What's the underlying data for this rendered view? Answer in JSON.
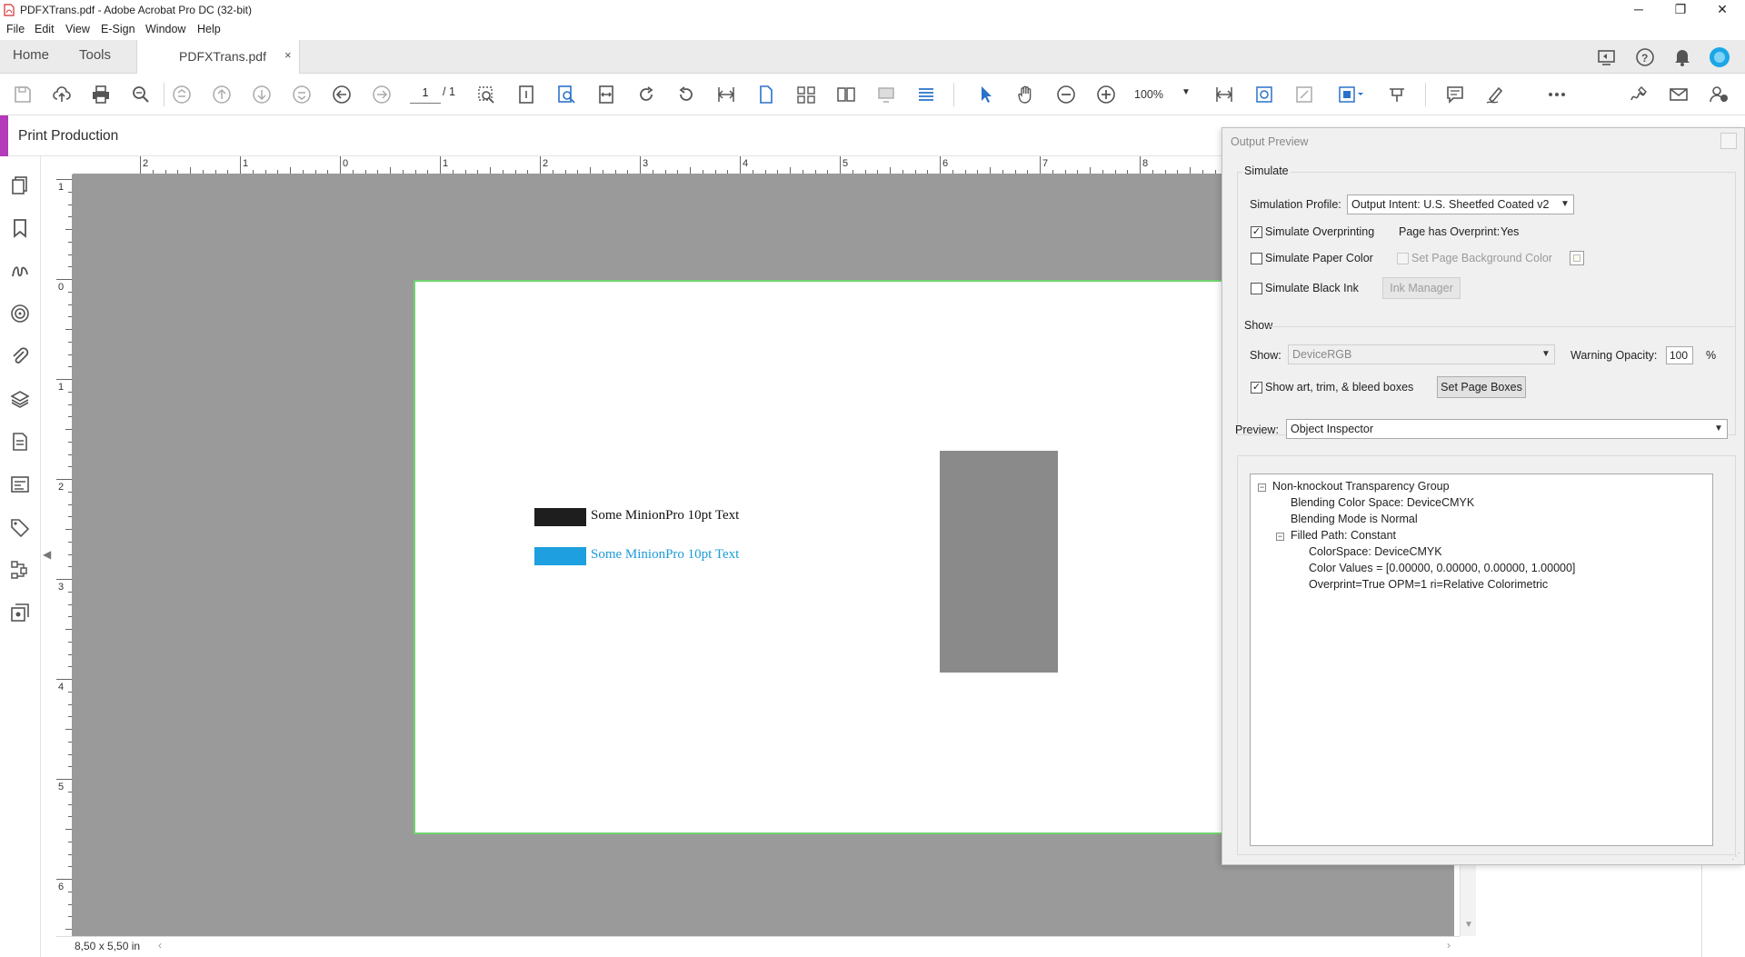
{
  "window": {
    "title": "PDFXTrans.pdf - Adobe Acrobat Pro DC (32-bit)"
  },
  "menu": [
    "File",
    "Edit",
    "View",
    "E-Sign",
    "Window",
    "Help"
  ],
  "tabs": {
    "home": "Home",
    "tools": "Tools",
    "document": "PDFXTrans.pdf",
    "close": "×"
  },
  "toolbar": {
    "page_current": "1",
    "page_total": "/ 1",
    "zoom": "100%"
  },
  "panel_title": "Print Production",
  "ruler": {
    "horizontal_labels": [
      "2",
      "1",
      "0",
      "1",
      "2",
      "3",
      "4",
      "5",
      "6",
      "7",
      "8"
    ],
    "vertical_labels": [
      "1",
      "0",
      "1",
      "2",
      "3",
      "4",
      "5",
      "6"
    ]
  },
  "page_content": {
    "line1": "Some MinionPro 10pt Text",
    "line2": "Some MinionPro 10pt Text",
    "colors": {
      "black_swatch": "#1e1e1e",
      "cyan_swatch": "#1d9fe0",
      "cyan_text": "#1b9bd7",
      "gray_rect": "#8a8a8a",
      "trim_box": "#6fd36f"
    }
  },
  "status": {
    "page_size": "8,50 x 5,50 in"
  },
  "dialog": {
    "title": "Output Preview",
    "simulate": {
      "group_label": "Simulate",
      "profile_label": "Simulation Profile:",
      "profile_value": "Output Intent: U.S. Sheetfed Coated v2",
      "simulate_overprinting": {
        "label": "Simulate Overprinting",
        "checked": true
      },
      "page_has_overprint_label": "Page has Overprint:",
      "page_has_overprint_value": "Yes",
      "simulate_paper_color": {
        "label": "Simulate Paper Color",
        "checked": false
      },
      "set_page_bg_color": {
        "label": "Set Page Background Color",
        "checked": false
      },
      "simulate_black_ink": {
        "label": "Simulate Black Ink",
        "checked": false
      },
      "ink_manager": "Ink Manager"
    },
    "show": {
      "group_label": "Show",
      "show_label": "Show:",
      "show_value": "DeviceRGB",
      "warning_opacity_label": "Warning Opacity:",
      "warning_opacity_value": "100",
      "percent": "%",
      "show_boxes": {
        "label": "Show art, trim, & bleed boxes",
        "checked": true
      },
      "set_page_boxes": "Set Page Boxes"
    },
    "preview_label": "Preview:",
    "preview_value": "Object Inspector",
    "tree": {
      "root": "Non-knockout Transparency Group",
      "blending_space": "Blending Color Space: DeviceCMYK",
      "blending_mode": "Blending Mode is Normal",
      "filled_path": "Filled Path: Constant",
      "colorspace": "ColorSpace: DeviceCMYK",
      "color_values": "Color Values = [0.00000, 0.00000, 0.00000, 1.00000]",
      "overprint": "Overprint=True OPM=1 ri=Relative Colorimetric"
    }
  }
}
